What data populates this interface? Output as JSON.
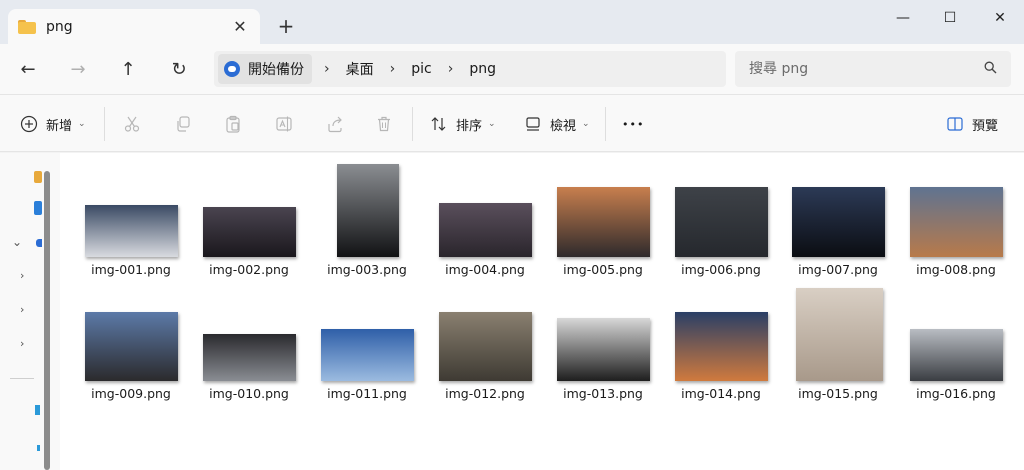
{
  "window": {
    "tab_title": "png",
    "tab_close": "✕",
    "new_tab": "+",
    "minimize": "—",
    "maximize": "☐",
    "close": "✕"
  },
  "nav": {
    "back": "←",
    "forward": "→",
    "up": "↑",
    "refresh": "↻"
  },
  "breadcrumb": {
    "root": "開始備份",
    "items": [
      "桌面",
      "pic",
      "png"
    ],
    "separator": "›"
  },
  "search": {
    "placeholder": "搜尋 png"
  },
  "toolbar": {
    "new_label": "新增",
    "sort_label": "排序",
    "view_label": "檢視",
    "more": "•••",
    "preview_label": "預覽"
  },
  "files": [
    {
      "name": "img-001.png",
      "c1": "#3a4a64",
      "c2": "#d9dbe0"
    },
    {
      "name": "img-002.png",
      "c1": "#4a4450",
      "c2": "#1a171c"
    },
    {
      "name": "img-003.png",
      "c1": "#8b8e92",
      "c2": "#111214"
    },
    {
      "name": "img-004.png",
      "c1": "#5a4f5c",
      "c2": "#2a252c"
    },
    {
      "name": "img-005.png",
      "c1": "#c87f4e",
      "c2": "#2e2a2c"
    },
    {
      "name": "img-006.png",
      "c1": "#3e4248",
      "c2": "#25282d"
    },
    {
      "name": "img-007.png",
      "c1": "#2c3a56",
      "c2": "#0b0d12"
    },
    {
      "name": "img-008.png",
      "c1": "#5f7391",
      "c2": "#b87a4a"
    },
    {
      "name": "img-009.png",
      "c1": "#5c7aa8",
      "c2": "#2b2a2c"
    },
    {
      "name": "img-010.png",
      "c1": "#2a2a2e",
      "c2": "#8a8d93"
    },
    {
      "name": "img-011.png",
      "c1": "#2f5fa8",
      "c2": "#9bbbe0"
    },
    {
      "name": "img-012.png",
      "c1": "#8a8070",
      "c2": "#3e3a33"
    },
    {
      "name": "img-013.png",
      "c1": "#d8d8d8",
      "c2": "#1e1e1e"
    },
    {
      "name": "img-014.png",
      "c1": "#2a3f66",
      "c2": "#d07a3e"
    },
    {
      "name": "img-015.png",
      "c1": "#d9cfc4",
      "c2": "#a8998a"
    },
    {
      "name": "img-016.png",
      "c1": "#b9bdc3",
      "c2": "#3a3d42"
    }
  ],
  "colors": {
    "accent": "#2b6cd4",
    "folder": "#f5c24c"
  }
}
